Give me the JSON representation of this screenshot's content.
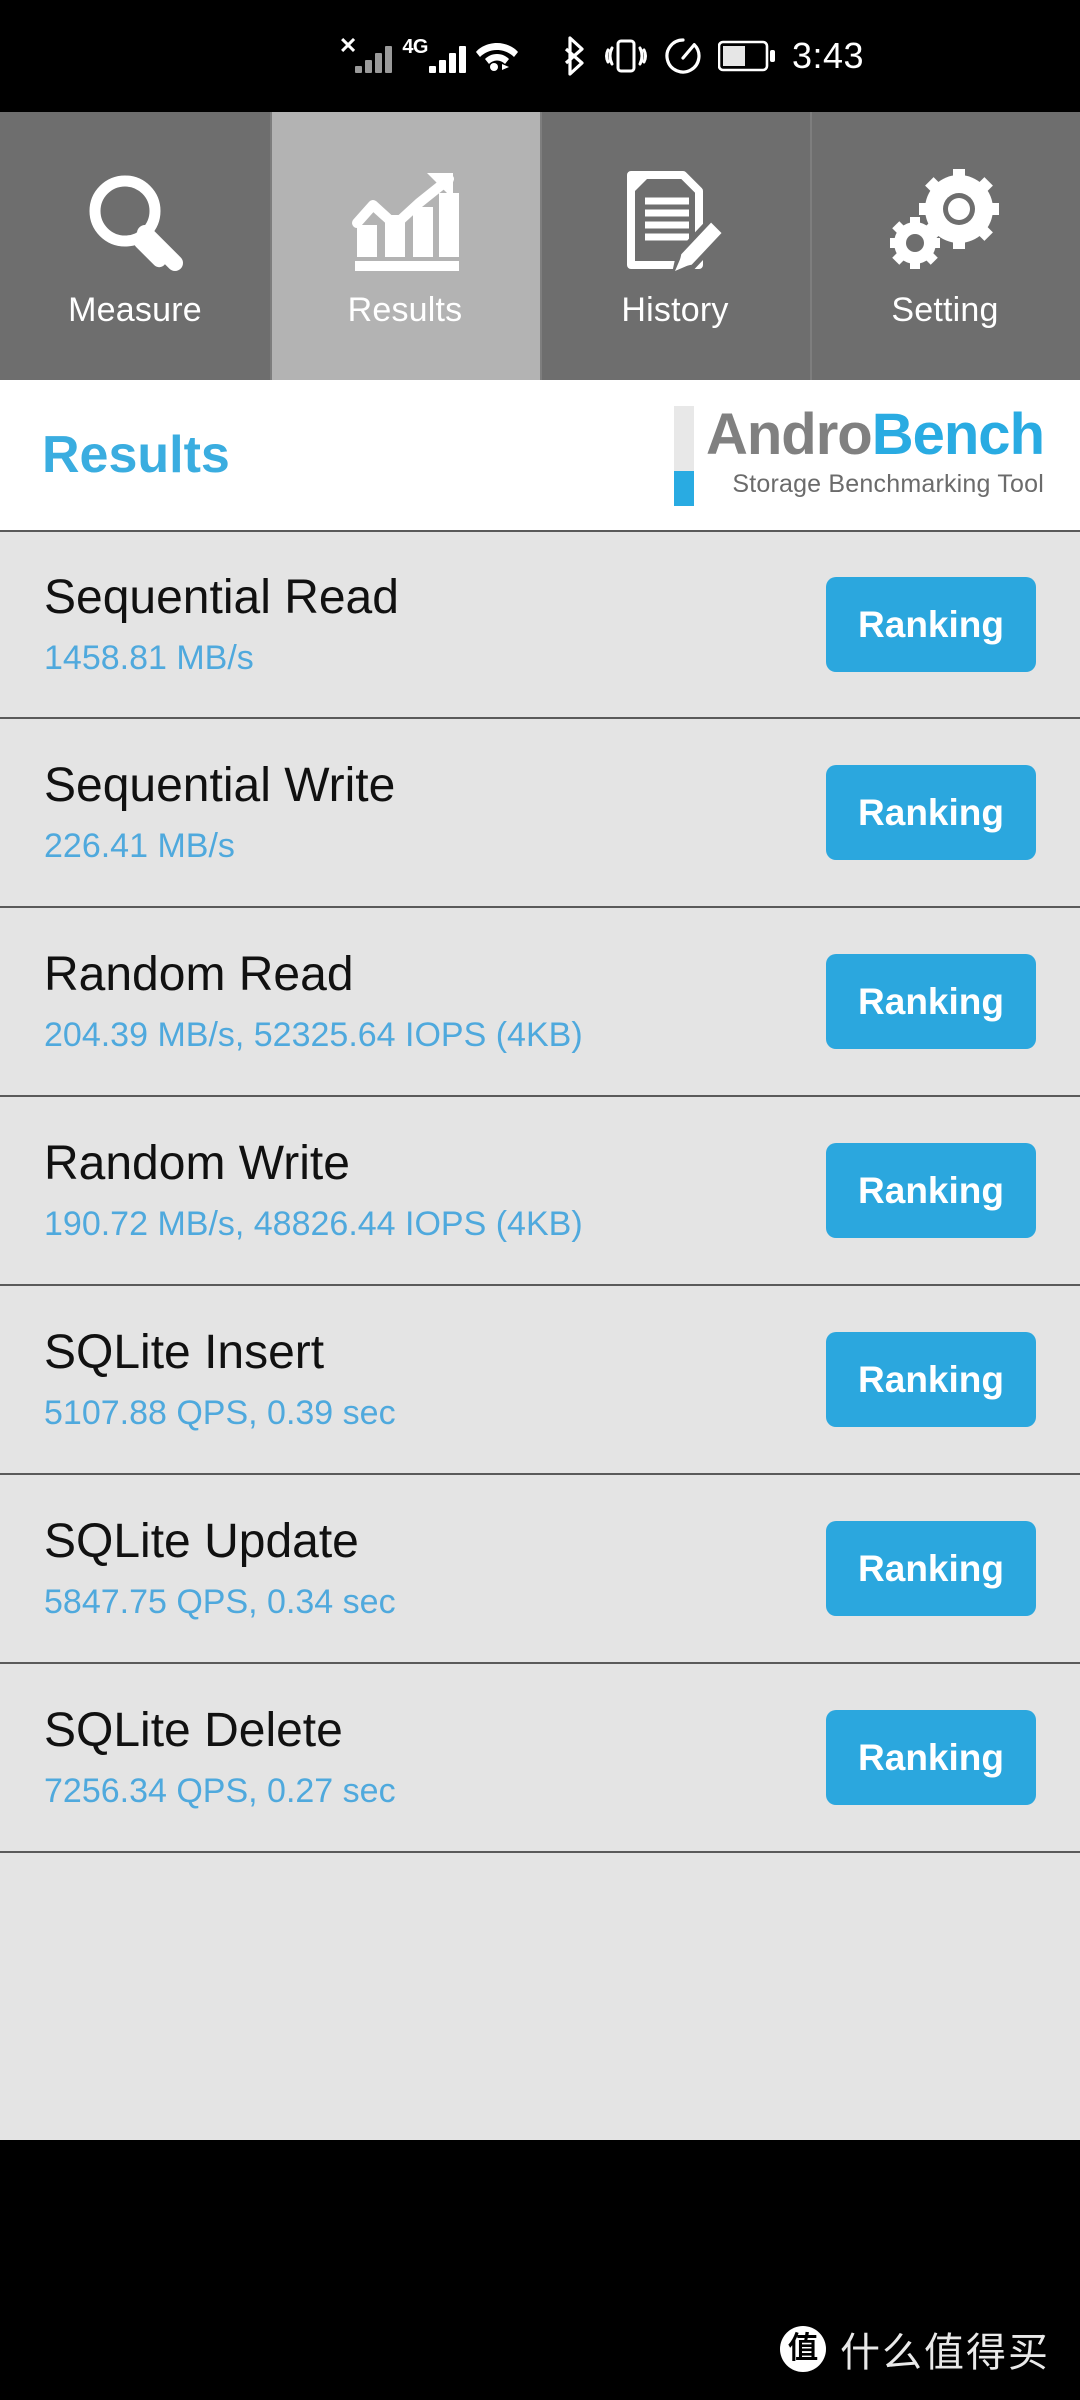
{
  "statusbar": {
    "time": "3:43",
    "network_label": "4G",
    "left_icons": [
      "signal-no-service-icon",
      "signal-bars-icon",
      "network-4g-label",
      "signal-bars-icon",
      "wifi-icon"
    ],
    "right_icons": [
      "bluetooth-icon",
      "vibrate-icon",
      "speedometer-icon",
      "battery-icon"
    ]
  },
  "tabs": [
    {
      "label": "Measure",
      "icon": "magnifier-icon",
      "active": false
    },
    {
      "label": "Results",
      "icon": "bar-chart-arrow-icon",
      "active": true
    },
    {
      "label": "History",
      "icon": "document-pencil-icon",
      "active": false
    },
    {
      "label": "Setting",
      "icon": "gears-icon",
      "active": false
    }
  ],
  "header": {
    "title": "Results",
    "logo_main_gray": "Andro",
    "logo_main_blue": "Bench",
    "logo_sub": "Storage Benchmarking Tool"
  },
  "results": [
    {
      "title": "Sequential Read",
      "value": "1458.81 MB/s",
      "button": "Ranking"
    },
    {
      "title": "Sequential Write",
      "value": "226.41 MB/s",
      "button": "Ranking"
    },
    {
      "title": "Random Read",
      "value": "204.39 MB/s, 52325.64 IOPS (4KB)",
      "button": "Ranking"
    },
    {
      "title": "Random Write",
      "value": "190.72 MB/s, 48826.44 IOPS (4KB)",
      "button": "Ranking"
    },
    {
      "title": "SQLite Insert",
      "value": "5107.88 QPS, 0.39 sec",
      "button": "Ranking"
    },
    {
      "title": "SQLite Update",
      "value": "5847.75 QPS, 0.34 sec",
      "button": "Ranking"
    },
    {
      "title": "SQLite Delete",
      "value": "7256.34 QPS, 0.27 sec",
      "button": "Ranking"
    }
  ],
  "watermark": {
    "logo_char": "值",
    "text": "什么值得买"
  },
  "colors": {
    "accent_blue": "#29abe2",
    "value_blue": "#4fa9dd",
    "tab_inactive": "#6e6e6e",
    "tab_active": "#b3b3b3",
    "list_bg": "#e4e4e4",
    "header_bg": "#ffffff"
  }
}
